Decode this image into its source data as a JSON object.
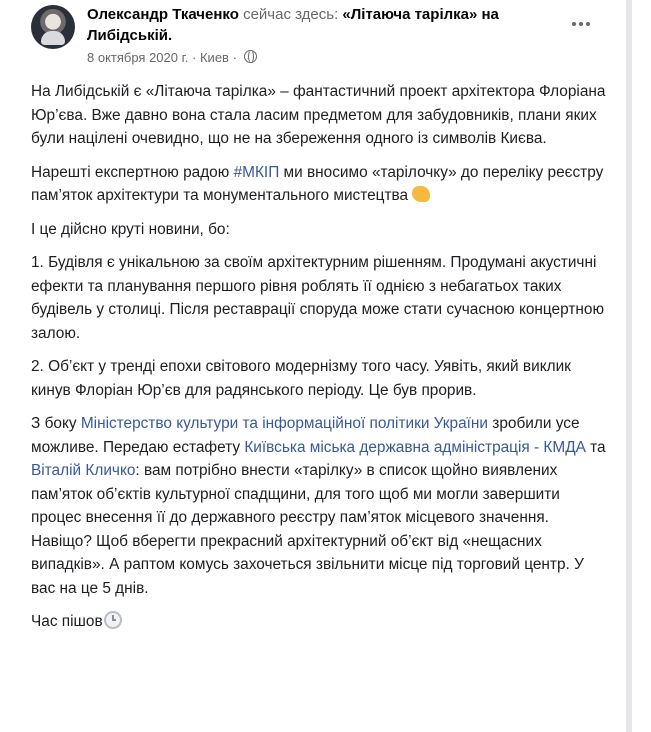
{
  "post": {
    "author": "Олександр Ткаченко",
    "status_text": "сейчас здесь:",
    "place": "«Літаюча тарілка» на Либідській.",
    "date": "8 октября 2020 г.",
    "separator": "·",
    "location": "Киев",
    "separator2": "·"
  },
  "body": {
    "p1": "На Либідській є «Літаюча тарілка» – фантастичний проект архітектора Флоріана Юр’єва. Вже давно вона стала ласим предметом для забудовників, плани яких були націлені очевидно, що не на збереження одного із символів Києва.",
    "p2_before": "Нарешті експертною радою ",
    "p2_hashtag": "#МКІП",
    "p2_after": " ми вносимо «тарілочку» до переліку реєстру пам’яток архітектури та монументального мистецтва",
    "p3": "І це дійсно круті новини, бо:",
    "p4": "1. Будівля є унікальною за своїм архітектурним рішенням. Продумані акустичні ефекти та планування першого рівня роблять її однією з небагатьох таких будівель у столиці. Після реставрації споруда може стати сучасною концертною залою.",
    "p5": "2. Об’єкт у тренді епохи світового модернізму того часу. Уявіть, який виклик кинув Флоріан Юр’єв для радянського періоду. Це був прорив.",
    "p6_a": "З боку ",
    "p6_link1": "Міністерство культури та інформаційної політики України",
    "p6_b": " зробили усе можливе. Передаю естафету ",
    "p6_link2": "Київська міська державна адміністрація - КМДА",
    "p6_c": " та ",
    "p6_link3": "Віталій Кличко",
    "p6_d": ": вам потрібно внести «тарілку» в список щойно виявлених пам’яток об’єктів культурної спадщини, для того щоб ми могли завершити процес внесення її до державного реєстру пам’яток місцевого значення. Навіщо? Щоб вберегти прекрасний архітектурний об’єкт від «нещасних випадків». А раптом комусь захочеться звільнити місце під торговий центр. У вас на це 5 днів.",
    "p7": "Час пішов"
  },
  "icons": {
    "avatar": "profile-photo",
    "more": "more-options-icon",
    "globe": "public-globe-icon",
    "emoji1": "flexed-biceps-emoji",
    "emoji2": "clock-emoji"
  },
  "colors": {
    "link": "#385898",
    "meta": "#65676b",
    "text": "#1c1e21"
  }
}
